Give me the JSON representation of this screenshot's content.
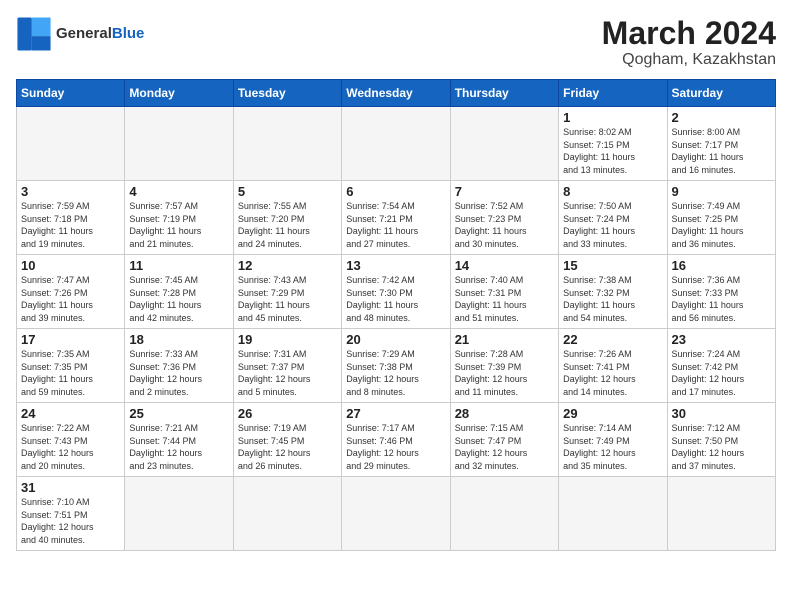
{
  "header": {
    "logo_general": "General",
    "logo_blue": "Blue",
    "month_year": "March 2024",
    "location": "Qogham, Kazakhstan"
  },
  "days_of_week": [
    "Sunday",
    "Monday",
    "Tuesday",
    "Wednesday",
    "Thursday",
    "Friday",
    "Saturday"
  ],
  "weeks": [
    [
      {
        "day": "",
        "info": ""
      },
      {
        "day": "",
        "info": ""
      },
      {
        "day": "",
        "info": ""
      },
      {
        "day": "",
        "info": ""
      },
      {
        "day": "",
        "info": ""
      },
      {
        "day": "1",
        "info": "Sunrise: 8:02 AM\nSunset: 7:15 PM\nDaylight: 11 hours\nand 13 minutes."
      },
      {
        "day": "2",
        "info": "Sunrise: 8:00 AM\nSunset: 7:17 PM\nDaylight: 11 hours\nand 16 minutes."
      }
    ],
    [
      {
        "day": "3",
        "info": "Sunrise: 7:59 AM\nSunset: 7:18 PM\nDaylight: 11 hours\nand 19 minutes."
      },
      {
        "day": "4",
        "info": "Sunrise: 7:57 AM\nSunset: 7:19 PM\nDaylight: 11 hours\nand 21 minutes."
      },
      {
        "day": "5",
        "info": "Sunrise: 7:55 AM\nSunset: 7:20 PM\nDaylight: 11 hours\nand 24 minutes."
      },
      {
        "day": "6",
        "info": "Sunrise: 7:54 AM\nSunset: 7:21 PM\nDaylight: 11 hours\nand 27 minutes."
      },
      {
        "day": "7",
        "info": "Sunrise: 7:52 AM\nSunset: 7:23 PM\nDaylight: 11 hours\nand 30 minutes."
      },
      {
        "day": "8",
        "info": "Sunrise: 7:50 AM\nSunset: 7:24 PM\nDaylight: 11 hours\nand 33 minutes."
      },
      {
        "day": "9",
        "info": "Sunrise: 7:49 AM\nSunset: 7:25 PM\nDaylight: 11 hours\nand 36 minutes."
      }
    ],
    [
      {
        "day": "10",
        "info": "Sunrise: 7:47 AM\nSunset: 7:26 PM\nDaylight: 11 hours\nand 39 minutes."
      },
      {
        "day": "11",
        "info": "Sunrise: 7:45 AM\nSunset: 7:28 PM\nDaylight: 11 hours\nand 42 minutes."
      },
      {
        "day": "12",
        "info": "Sunrise: 7:43 AM\nSunset: 7:29 PM\nDaylight: 11 hours\nand 45 minutes."
      },
      {
        "day": "13",
        "info": "Sunrise: 7:42 AM\nSunset: 7:30 PM\nDaylight: 11 hours\nand 48 minutes."
      },
      {
        "day": "14",
        "info": "Sunrise: 7:40 AM\nSunset: 7:31 PM\nDaylight: 11 hours\nand 51 minutes."
      },
      {
        "day": "15",
        "info": "Sunrise: 7:38 AM\nSunset: 7:32 PM\nDaylight: 11 hours\nand 54 minutes."
      },
      {
        "day": "16",
        "info": "Sunrise: 7:36 AM\nSunset: 7:33 PM\nDaylight: 11 hours\nand 56 minutes."
      }
    ],
    [
      {
        "day": "17",
        "info": "Sunrise: 7:35 AM\nSunset: 7:35 PM\nDaylight: 11 hours\nand 59 minutes."
      },
      {
        "day": "18",
        "info": "Sunrise: 7:33 AM\nSunset: 7:36 PM\nDaylight: 12 hours\nand 2 minutes."
      },
      {
        "day": "19",
        "info": "Sunrise: 7:31 AM\nSunset: 7:37 PM\nDaylight: 12 hours\nand 5 minutes."
      },
      {
        "day": "20",
        "info": "Sunrise: 7:29 AM\nSunset: 7:38 PM\nDaylight: 12 hours\nand 8 minutes."
      },
      {
        "day": "21",
        "info": "Sunrise: 7:28 AM\nSunset: 7:39 PM\nDaylight: 12 hours\nand 11 minutes."
      },
      {
        "day": "22",
        "info": "Sunrise: 7:26 AM\nSunset: 7:41 PM\nDaylight: 12 hours\nand 14 minutes."
      },
      {
        "day": "23",
        "info": "Sunrise: 7:24 AM\nSunset: 7:42 PM\nDaylight: 12 hours\nand 17 minutes."
      }
    ],
    [
      {
        "day": "24",
        "info": "Sunrise: 7:22 AM\nSunset: 7:43 PM\nDaylight: 12 hours\nand 20 minutes."
      },
      {
        "day": "25",
        "info": "Sunrise: 7:21 AM\nSunset: 7:44 PM\nDaylight: 12 hours\nand 23 minutes."
      },
      {
        "day": "26",
        "info": "Sunrise: 7:19 AM\nSunset: 7:45 PM\nDaylight: 12 hours\nand 26 minutes."
      },
      {
        "day": "27",
        "info": "Sunrise: 7:17 AM\nSunset: 7:46 PM\nDaylight: 12 hours\nand 29 minutes."
      },
      {
        "day": "28",
        "info": "Sunrise: 7:15 AM\nSunset: 7:47 PM\nDaylight: 12 hours\nand 32 minutes."
      },
      {
        "day": "29",
        "info": "Sunrise: 7:14 AM\nSunset: 7:49 PM\nDaylight: 12 hours\nand 35 minutes."
      },
      {
        "day": "30",
        "info": "Sunrise: 7:12 AM\nSunset: 7:50 PM\nDaylight: 12 hours\nand 37 minutes."
      }
    ],
    [
      {
        "day": "31",
        "info": "Sunrise: 7:10 AM\nSunset: 7:51 PM\nDaylight: 12 hours\nand 40 minutes."
      },
      {
        "day": "",
        "info": ""
      },
      {
        "day": "",
        "info": ""
      },
      {
        "day": "",
        "info": ""
      },
      {
        "day": "",
        "info": ""
      },
      {
        "day": "",
        "info": ""
      },
      {
        "day": "",
        "info": ""
      }
    ]
  ]
}
